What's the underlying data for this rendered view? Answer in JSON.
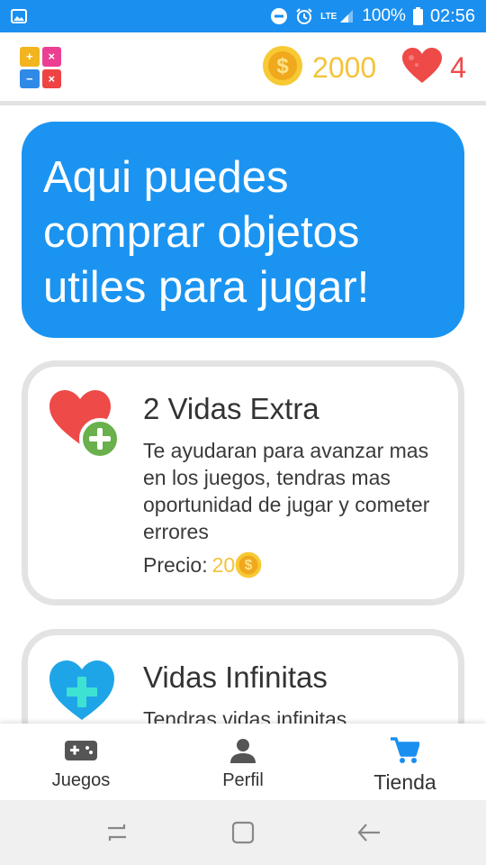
{
  "status_bar": {
    "network": "LTE",
    "battery": "100%",
    "time": "02:56"
  },
  "header": {
    "coins": "2000",
    "lives": "4"
  },
  "banner": {
    "text": "Aqui puedes comprar objetos utiles para jugar!"
  },
  "shop_items": [
    {
      "title": "2 Vidas Extra",
      "description": "Te ayudaran para avanzar mas en los juegos, tendras mas oportunidad de jugar y cometer errores",
      "price_label": "Precio:",
      "price": "20"
    },
    {
      "title": "Vidas Infinitas",
      "description": "Tendras vidas infinitas"
    }
  ],
  "bottom_nav": {
    "items": [
      {
        "label": "Juegos",
        "icon": "gamepad-icon"
      },
      {
        "label": "Perfil",
        "icon": "person-icon"
      },
      {
        "label": "Tienda",
        "icon": "cart-icon"
      }
    ],
    "active_index": 2
  },
  "colors": {
    "primary": "#1b94f1",
    "coin": "#f3c43a",
    "heart": "#ee4a48",
    "plus_green": "#6ab04c",
    "heart_blue": "#1ea5e8"
  }
}
